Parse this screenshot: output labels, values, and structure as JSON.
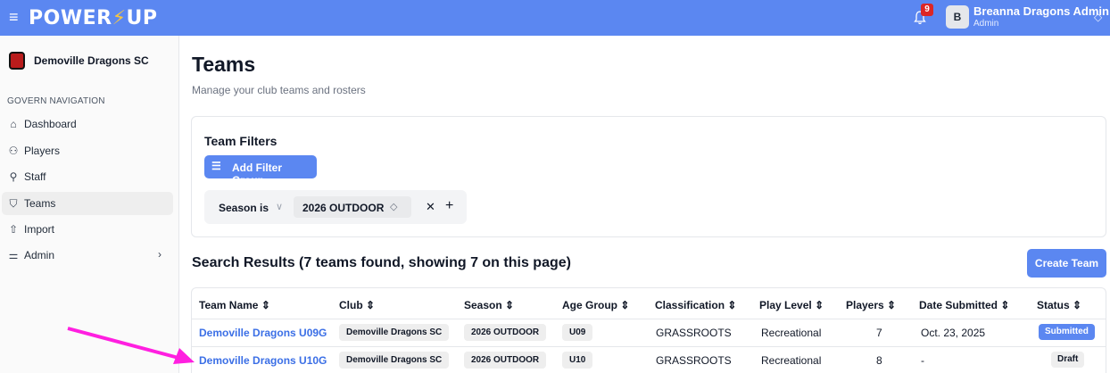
{
  "topbar": {
    "menu_icon": "hamburger-icon",
    "brand_part1": "POWER",
    "brand_bolt": "⚡",
    "brand_part2": "UP",
    "notifications_count": "9",
    "avatar_initial": "B",
    "user_name": "Breanna Dragons Admin",
    "user_role": "Admin"
  },
  "sidebar": {
    "club_name": "Demoville Dragons SC",
    "nav_heading": "GOVERN NAVIGATION",
    "items": [
      {
        "label": "Dashboard",
        "icon": "home-icon"
      },
      {
        "label": "Players",
        "icon": "users-icon"
      },
      {
        "label": "Staff",
        "icon": "staff-icon"
      },
      {
        "label": "Teams",
        "icon": "shield-icon"
      },
      {
        "label": "Import",
        "icon": "upload-icon"
      },
      {
        "label": "Admin",
        "icon": "settings-icon"
      }
    ]
  },
  "page": {
    "title": "Teams",
    "subtitle": "Manage your club teams and rosters"
  },
  "filters": {
    "title": "Team Filters",
    "add_button": "Add Filter Group",
    "rule": {
      "field": "Season",
      "operator": "is",
      "value": "2026 OUTDOOR"
    }
  },
  "results": {
    "title": "Search Results (7 teams found, showing 7 on this page)",
    "create_button": "Create Team",
    "columns": [
      "Team Name",
      "Club",
      "Season",
      "Age Group",
      "Classification",
      "Play Level",
      "Players",
      "Date Submitted",
      "Status"
    ],
    "rows": [
      {
        "team": "Demoville Dragons U09G",
        "club": "Demoville Dragons SC",
        "season": "2026 OUTDOOR",
        "age": "U09",
        "classification": "GRASSROOTS",
        "level": "Recreational",
        "players": "7",
        "date": "Oct. 23, 2025",
        "status": "Submitted"
      },
      {
        "team": "Demoville Dragons U10G",
        "club": "Demoville Dragons SC",
        "season": "2026 OUTDOOR",
        "age": "U10",
        "classification": "GRASSROOTS",
        "level": "Recreational",
        "players": "8",
        "date": "-",
        "status": "Draft"
      }
    ]
  },
  "colors": {
    "primary": "#5b87f1",
    "link": "#3b6fe6",
    "annotation_arrow": "#ff1fe0"
  }
}
